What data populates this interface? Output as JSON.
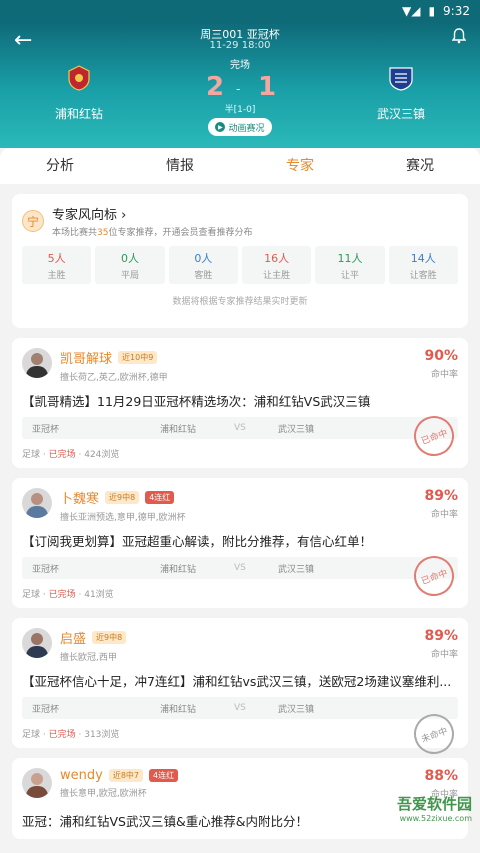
{
  "status_bar": {
    "time": "9:32"
  },
  "match": {
    "title": "周三001 亚冠杯",
    "date": "11-29 18:00",
    "status": "完场",
    "home_team": "浦和红钻",
    "away_team": "武汉三镇",
    "home_score": "2",
    "away_score": "1",
    "half": "半[1-0]",
    "animation_label": "动画赛况"
  },
  "tabs": [
    {
      "label": "分析"
    },
    {
      "label": "情报"
    },
    {
      "label": "专家"
    },
    {
      "label": "赛况"
    }
  ],
  "vane": {
    "title": "专家风向标",
    "sub_prefix": "本场比赛共",
    "expert_count": "35",
    "sub_suffix": "位专家推荐，开通会员查看推荐分布",
    "stats": [
      {
        "value": "5人",
        "label": "主胜"
      },
      {
        "value": "0人",
        "label": "平局"
      },
      {
        "value": "0人",
        "label": "客胜"
      },
      {
        "value": "16人",
        "label": "让主胜"
      },
      {
        "value": "11人",
        "label": "让平"
      },
      {
        "value": "14人",
        "label": "让客胜"
      }
    ],
    "note": "数据将根据专家推荐结果实时更新"
  },
  "posts": [
    {
      "name": "凯哥解球",
      "badge": "近10中9",
      "streak": "",
      "skill": "擅长荷乙,英乙,欧洲杯,德甲",
      "rate": "90%",
      "rate_label": "命中率",
      "title": "【凯哥精选】11月29日亚冠杯精选场次：浦和红钻VS武汉三镇",
      "league": "亚冠杯",
      "home": "浦和红钻",
      "vs": "VS",
      "away": "武汉三镇",
      "sport": "足球",
      "state": "已完场",
      "views": "424浏览",
      "stamp": "已命中"
    },
    {
      "name": "卜魏寒",
      "badge": "近9中8",
      "streak": "4连红",
      "skill": "擅长亚洲预选,意甲,德甲,欧洲杯",
      "rate": "89%",
      "rate_label": "命中率",
      "title": "【订阅我更划算】亚冠超重心解读，附比分推荐，有信心红单！",
      "league": "亚冠杯",
      "home": "浦和红钻",
      "vs": "VS",
      "away": "武汉三镇",
      "sport": "足球",
      "state": "已完场",
      "views": "41浏览",
      "stamp": "已命中"
    },
    {
      "name": "启盛",
      "badge": "近9中8",
      "streak": "",
      "skill": "擅长欧冠,西甲",
      "rate": "89%",
      "rate_label": "命中率",
      "title": "【亚冠杯信心十足，冲7连红】浦和红钻vs武汉三镇，送欧冠2场建议塞维利...",
      "league": "亚冠杯",
      "home": "浦和红钻",
      "vs": "VS",
      "away": "武汉三镇",
      "sport": "足球",
      "state": "已完场",
      "views": "313浏览",
      "stamp": "未命中"
    },
    {
      "name": "wendy",
      "badge": "近8中7",
      "streak": "4连红",
      "skill": "擅长意甲,欧冠,欧洲杯",
      "rate": "88%",
      "rate_label": "命中率",
      "title": "亚冠：浦和红钻VS武汉三镇&重心推荐&内附比分！"
    }
  ],
  "watermark": {
    "text": "吾爱软件园",
    "url": "www.52zixue.com"
  },
  "colors": {
    "header": "#1aa0a8",
    "accent": "#e8892a",
    "hit": "#e05a4e"
  }
}
